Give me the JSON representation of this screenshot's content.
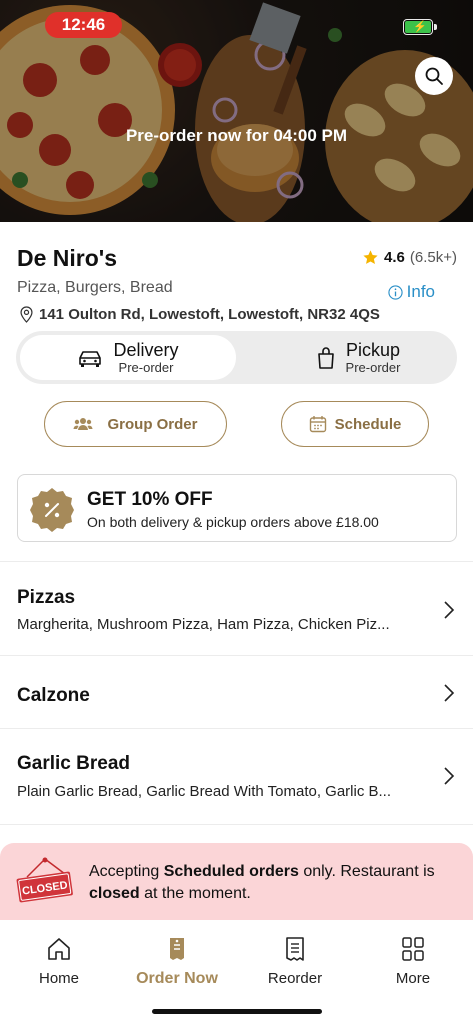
{
  "status_bar": {
    "time": "12:46"
  },
  "hero": {
    "preorder_text": "Pre-order now for 04:00 PM"
  },
  "restaurant": {
    "name": "De Niro's",
    "rating": "4.6",
    "rating_count": "(6.5k+)",
    "cuisine": "Pizza, Burgers, Bread",
    "info_label": "Info",
    "address": "141 Oulton Rd, Lowestoft, Lowestoft, NR32 4QS"
  },
  "order_mode": {
    "delivery": {
      "label": "Delivery",
      "sub": "Pre-order",
      "selected": true
    },
    "pickup": {
      "label": "Pickup",
      "sub": "Pre-order",
      "selected": false
    }
  },
  "actions": {
    "group_order": "Group Order",
    "schedule": "Schedule"
  },
  "offer": {
    "title": "GET 10% OFF",
    "subtitle": "On both delivery & pickup orders above £18.00"
  },
  "categories": [
    {
      "title": "Pizzas",
      "items": "Margherita, Mushroom Pizza, Ham Pizza, Chicken Piz..."
    },
    {
      "title": "Calzone",
      "items": ""
    },
    {
      "title": "Garlic Bread",
      "items": "Plain Garlic Bread, Garlic Bread With Tomato, Garlic B..."
    }
  ],
  "closed_notice": {
    "sign": "CLOSED",
    "msg_part1": "Accepting ",
    "msg_bold1": "Scheduled orders",
    "msg_part2": " only. Restaurant is ",
    "msg_bold2": "closed",
    "msg_part3": " at the moment."
  },
  "tabs": [
    {
      "label": "Home",
      "icon": "home-icon",
      "active": false
    },
    {
      "label": "Order Now",
      "icon": "order-icon",
      "active": true
    },
    {
      "label": "Reorder",
      "icon": "receipt-icon",
      "active": false
    },
    {
      "label": "More",
      "icon": "grid-icon",
      "active": false
    }
  ],
  "colors": {
    "accent": "#a68a5a",
    "info": "#2a8fc7",
    "closed_bg": "#fbd5d7",
    "time_pill": "#e0302a",
    "star": "#f5b400"
  }
}
